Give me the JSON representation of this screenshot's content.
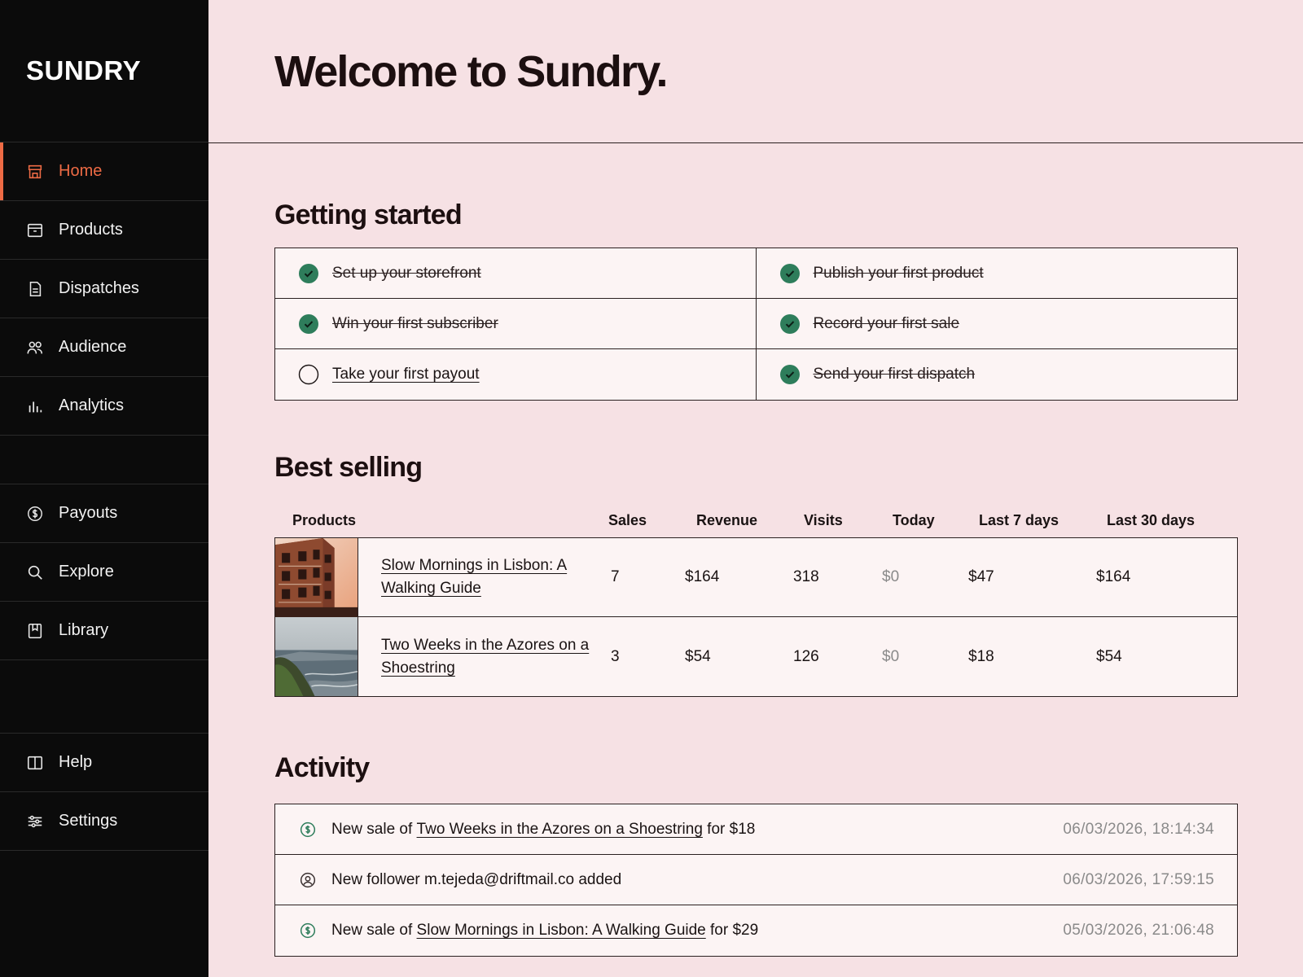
{
  "app": {
    "brand": "SUNDRY",
    "accent_color": "#ee6b45",
    "success_color": "#2e7d5b"
  },
  "sidebar": {
    "items": [
      {
        "label": "Home",
        "icon": "store-icon",
        "active": true
      },
      {
        "label": "Products",
        "icon": "archive-box-icon"
      },
      {
        "label": "Dispatches",
        "icon": "document-icon"
      },
      {
        "label": "Audience",
        "icon": "users-icon"
      },
      {
        "label": "Analytics",
        "icon": "bar-chart-icon"
      },
      {
        "label": "Payouts",
        "icon": "dollar-circle-icon"
      },
      {
        "label": "Explore",
        "icon": "search-icon"
      },
      {
        "label": "Library",
        "icon": "bookmark-icon"
      },
      {
        "label": "Help",
        "icon": "book-open-icon"
      },
      {
        "label": "Settings",
        "icon": "sliders-icon"
      }
    ]
  },
  "header": {
    "title": "Welcome to Sundry."
  },
  "getting_started": {
    "title": "Getting started",
    "tasks": [
      {
        "label": "Set up your storefront",
        "done": true
      },
      {
        "label": "Publish your first product",
        "done": true
      },
      {
        "label": "Win your first subscriber",
        "done": true
      },
      {
        "label": "Record your first sale",
        "done": true
      },
      {
        "label": "Take your first payout",
        "done": false
      },
      {
        "label": "Send your first dispatch",
        "done": true
      }
    ]
  },
  "best_selling": {
    "title": "Best selling",
    "columns": [
      "Products",
      "Sales",
      "Revenue",
      "Visits",
      "Today",
      "Last 7 days",
      "Last 30 days"
    ],
    "rows": [
      {
        "product": "Slow Mornings in Lisbon: A Walking Guide",
        "sales": "7",
        "revenue": "$164",
        "visits": "318",
        "today": "$0",
        "last7": "$47",
        "last30": "$164",
        "thumb": "lisbon-building-image"
      },
      {
        "product": "Two Weeks in the Azores on a Shoestring",
        "sales": "3",
        "revenue": "$54",
        "visits": "126",
        "today": "$0",
        "last7": "$18",
        "last30": "$54",
        "thumb": "azores-coast-image"
      }
    ]
  },
  "activity": {
    "title": "Activity",
    "items": [
      {
        "icon": "dollar-circle-icon",
        "prefix": "New sale of ",
        "link": "Two Weeks in the Azores on a Shoestring",
        "suffix": " for $18",
        "time": "06/03/2026, 18:14:34"
      },
      {
        "icon": "user-circle-icon",
        "prefix": "New follower m.tejeda@driftmail.co added",
        "link": "",
        "suffix": "",
        "time": "06/03/2026, 17:59:15"
      },
      {
        "icon": "dollar-circle-icon",
        "prefix": "New sale of ",
        "link": "Slow Mornings in Lisbon: A Walking Guide",
        "suffix": " for $29",
        "time": "05/03/2026, 21:06:48"
      }
    ]
  }
}
